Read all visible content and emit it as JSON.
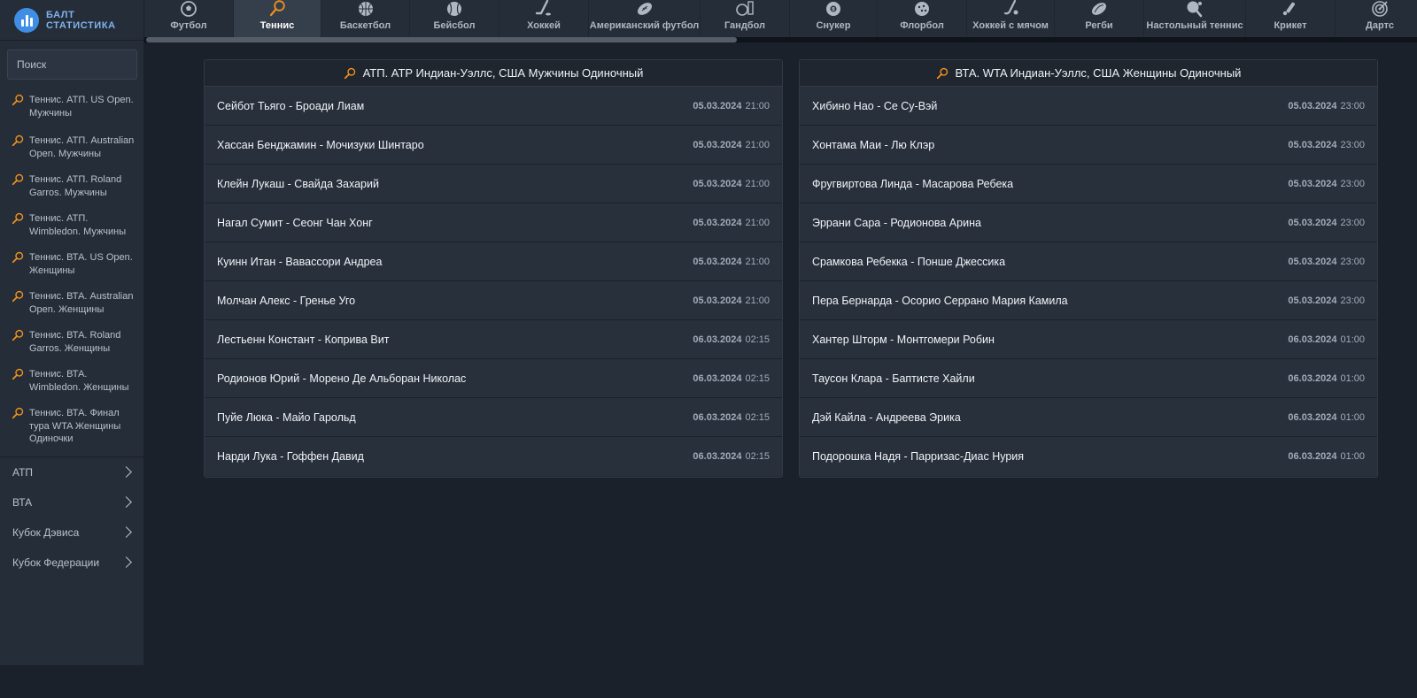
{
  "brand": {
    "line1": "БАЛТ",
    "line2": "СТАТИСТИКА"
  },
  "search": {
    "placeholder": "Поиск"
  },
  "sports": [
    {
      "label": "Футбол",
      "icon": "soccer-ball-icon",
      "active": false
    },
    {
      "label": "Теннис",
      "icon": "tennis-racket-icon",
      "active": true
    },
    {
      "label": "Баскетбол",
      "icon": "basketball-icon",
      "active": false
    },
    {
      "label": "Бейсбол",
      "icon": "baseball-icon",
      "active": false
    },
    {
      "label": "Хоккей",
      "icon": "hockey-stick-icon",
      "active": false
    },
    {
      "label": "Американский футбол",
      "icon": "american-football-icon",
      "active": false
    },
    {
      "label": "Гандбол",
      "icon": "handball-icon",
      "active": false
    },
    {
      "label": "Снукер",
      "icon": "snooker-ball-icon",
      "active": false
    },
    {
      "label": "Флорбол",
      "icon": "floorball-icon",
      "active": false
    },
    {
      "label": "Хоккей с мячом",
      "icon": "bandy-icon",
      "active": false
    },
    {
      "label": "Регби",
      "icon": "rugby-ball-icon",
      "active": false
    },
    {
      "label": "Настольный теннис",
      "icon": "table-tennis-icon",
      "active": false
    },
    {
      "label": "Крикет",
      "icon": "cricket-icon",
      "active": false
    },
    {
      "label": "Дартс",
      "icon": "darts-icon",
      "active": false
    }
  ],
  "sidebar": {
    "tournaments": [
      {
        "label": "Теннис. АТП. US Open. Мужчины"
      },
      {
        "label": "Теннис. АТП. Australian Open. Мужчины"
      },
      {
        "label": "Теннис. АТП. Roland Garros. Мужчины"
      },
      {
        "label": "Теннис. АТП. Wimbledon. Мужчины"
      },
      {
        "label": "Теннис. ВТА. US Open. Женщины"
      },
      {
        "label": "Теннис. ВТА. Australian Open. Женщины"
      },
      {
        "label": "Теннис. ВТА. Roland Garros. Женщины"
      },
      {
        "label": "Теннис. ВТА. Wimbledon. Женщины"
      },
      {
        "label": "Теннис. ВТА. Финал тура WTA Женщины Одиночки"
      }
    ],
    "categories": [
      {
        "label": "АТП"
      },
      {
        "label": "ВТА"
      },
      {
        "label": "Кубок Дэвиса"
      },
      {
        "label": "Кубок Федерации"
      }
    ]
  },
  "panels": [
    {
      "title": "АТП. ATP Индиан-Уэллс, США Мужчины Одиночный",
      "matches": [
        {
          "name": "Сейбот Тьяго - Броади Лиам",
          "date": "05.03.2024",
          "time": "21:00"
        },
        {
          "name": "Хассан Бенджамин - Мочизуки Шинтаро",
          "date": "05.03.2024",
          "time": "21:00"
        },
        {
          "name": "Клейн Лукаш - Свайда Захарий",
          "date": "05.03.2024",
          "time": "21:00"
        },
        {
          "name": "Нагал Сумит - Сеонг Чан Хонг",
          "date": "05.03.2024",
          "time": "21:00"
        },
        {
          "name": "Куинн Итан - Вавассори Андреа",
          "date": "05.03.2024",
          "time": "21:00"
        },
        {
          "name": "Молчан Алекс - Гренье Уго",
          "date": "05.03.2024",
          "time": "21:00"
        },
        {
          "name": "Лестьенн Констант - Коприва Вит",
          "date": "06.03.2024",
          "time": "02:15"
        },
        {
          "name": "Родионов Юрий - Морено Де Альборан Николас",
          "date": "06.03.2024",
          "time": "02:15"
        },
        {
          "name": "Пуйе Люка - Майо Гарольд",
          "date": "06.03.2024",
          "time": "02:15"
        },
        {
          "name": "Нарди Лука - Гоффен Давид",
          "date": "06.03.2024",
          "time": "02:15"
        }
      ]
    },
    {
      "title": "ВТА. WTA Индиан-Уэллс, США Женщины Одиночный",
      "matches": [
        {
          "name": "Хибино Нао - Се Су-Вэй",
          "date": "05.03.2024",
          "time": "23:00"
        },
        {
          "name": "Хонтама Маи - Лю Клэр",
          "date": "05.03.2024",
          "time": "23:00"
        },
        {
          "name": "Фругвиртова Линда - Масарова Ребека",
          "date": "05.03.2024",
          "time": "23:00"
        },
        {
          "name": "Эррани Сара - Родионова Арина",
          "date": "05.03.2024",
          "time": "23:00"
        },
        {
          "name": "Срамкова Ребекка - Понше Джессика",
          "date": "05.03.2024",
          "time": "23:00"
        },
        {
          "name": "Пера Бернарда - Осорио Серрано Мария Камила",
          "date": "05.03.2024",
          "time": "23:00"
        },
        {
          "name": "Хантер Шторм - Монтгомери Робин",
          "date": "06.03.2024",
          "time": "01:00"
        },
        {
          "name": "Таусон Клара - Баптисте Хайли",
          "date": "06.03.2024",
          "time": "01:00"
        },
        {
          "name": "Дэй Кайла - Андреева Эрика",
          "date": "06.03.2024",
          "time": "01:00"
        },
        {
          "name": "Подорошка Надя - Парризас-Диас Нурия",
          "date": "06.03.2024",
          "time": "01:00"
        }
      ]
    }
  ],
  "colors": {
    "accent": "#f0901e",
    "brand": "#3f8ee6"
  }
}
